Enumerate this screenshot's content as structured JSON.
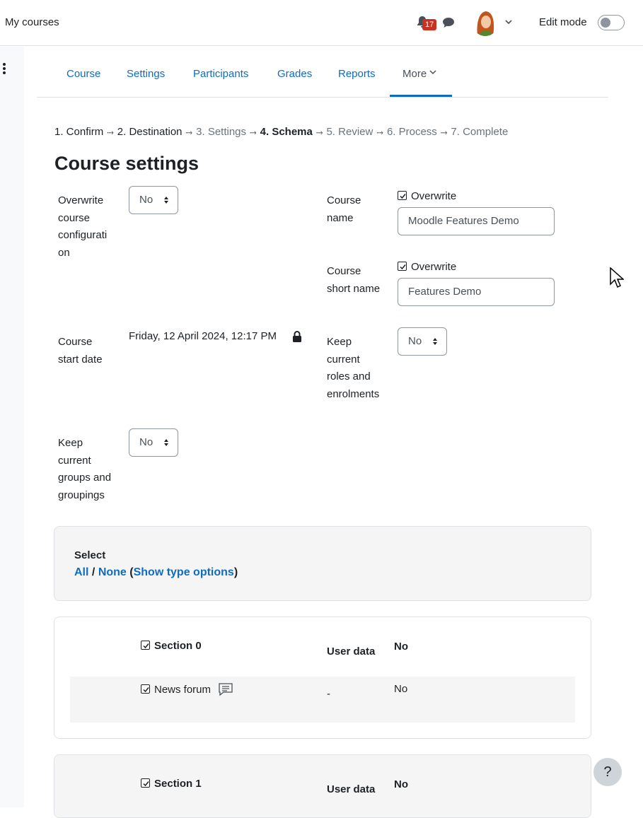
{
  "navbar": {
    "my_courses": "My courses",
    "notification_count": "17",
    "edit_mode_label": "Edit mode"
  },
  "secondary_nav": {
    "items": [
      "Course",
      "Settings",
      "Participants",
      "Grades",
      "Reports"
    ],
    "more": "More"
  },
  "steps": [
    {
      "label": "1. Confirm",
      "state": "done"
    },
    {
      "label": "2. Destination",
      "state": "done"
    },
    {
      "label": "3. Settings",
      "state": "upcoming"
    },
    {
      "label": "4. Schema",
      "state": "current"
    },
    {
      "label": "5. Review",
      "state": "upcoming"
    },
    {
      "label": "6. Process",
      "state": "upcoming"
    },
    {
      "label": "7. Complete",
      "state": "upcoming"
    }
  ],
  "page_title": "Course settings",
  "form": {
    "overwrite_config": {
      "label_lines": [
        "Overwrite",
        "course",
        "configurati",
        "on"
      ],
      "value": "No"
    },
    "course_name": {
      "label_lines": [
        "Course",
        "name"
      ],
      "overwrite_label": "Overwrite",
      "overwrite_checked": true,
      "value": "Moodle Features Demo"
    },
    "course_short_name": {
      "label_lines": [
        "Course",
        "short name"
      ],
      "overwrite_label": "Overwrite",
      "overwrite_checked": true,
      "value": "Features Demo"
    },
    "course_start_date": {
      "label_lines": [
        "Course",
        "start date"
      ],
      "value": "Friday, 12 April 2024, 12:17 PM"
    },
    "keep_roles": {
      "label_lines": [
        "Keep",
        "current",
        "roles and",
        "enrolments"
      ],
      "value": "No"
    },
    "keep_groups": {
      "label_lines": [
        "Keep",
        "current",
        "groups and",
        "groupings"
      ],
      "value": "No"
    }
  },
  "select_box": {
    "title": "Select",
    "all": "All",
    "sep": "/",
    "none": "None",
    "show_type_options": "Show type options"
  },
  "sections": [
    {
      "title": "Section 0",
      "user_data_label": "User data",
      "user_data_value": "No",
      "activities": [
        {
          "name": "News forum",
          "icon": "forum-icon",
          "user_data": "-",
          "value": "No"
        }
      ]
    },
    {
      "title": "Section 1",
      "user_data_label": "User data",
      "user_data_value": "No"
    }
  ],
  "help_button": "?",
  "colors": {
    "link": "#0f6cbf",
    "badge": "#ca3120",
    "panel": "#f5f5f5"
  }
}
